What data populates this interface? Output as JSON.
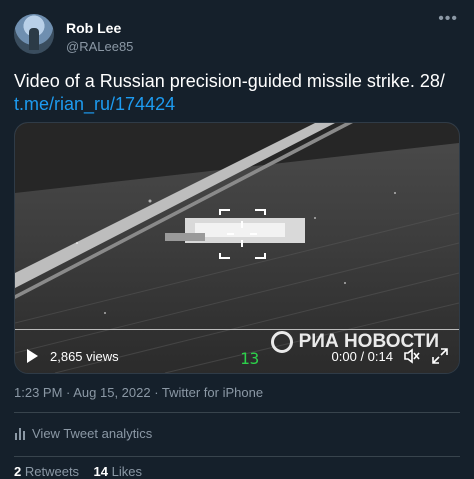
{
  "author": {
    "display_name": "Rob Lee",
    "handle": "@RALee85"
  },
  "tweet": {
    "text": "Video of a Russian precision-guided missile strike. 28/",
    "link": "t.me/rian_ru/174424"
  },
  "video": {
    "views": "2,865 views",
    "time": "0:00 / 0:14",
    "watermark": "РИА НОВОСТИ",
    "osd_number": "13"
  },
  "meta": {
    "timestamp": "1:23 PM · Aug 15, 2022 · Twitter for iPhone"
  },
  "analytics": {
    "label": "View Tweet analytics"
  },
  "stats": {
    "retweets_count": "2",
    "retweets_label": "Retweets",
    "likes_count": "14",
    "likes_label": "Likes"
  },
  "icons": {
    "more": "more-icon",
    "play": "play-icon",
    "volume": "volume-icon",
    "fullscreen": "fullscreen-icon",
    "analytics": "bar-chart-icon"
  },
  "colors": {
    "background": "#15202b",
    "link": "#1d9bf0",
    "muted": "#8b98a5"
  }
}
